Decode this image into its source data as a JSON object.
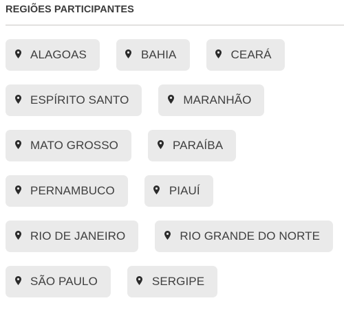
{
  "section": {
    "title": "REGIÕES PARTICIPANTES"
  },
  "icons": {
    "chip_icon": "map-pin-icon"
  },
  "colors": {
    "chip_background": "#eaeaea",
    "text": "#3f3f3f",
    "divider": "#c9c6c4"
  },
  "regions": [
    "ALAGOAS",
    "BAHIA",
    "CEARÁ",
    "ESPÍRITO SANTO",
    "MARANHÃO",
    "MATO GROSSO",
    "PARAÍBA",
    "PERNAMBUCO",
    "PIAUÍ",
    "RIO DE JANEIRO",
    "RIO GRANDE DO NORTE",
    "SÃO PAULO",
    "SERGIPE"
  ]
}
